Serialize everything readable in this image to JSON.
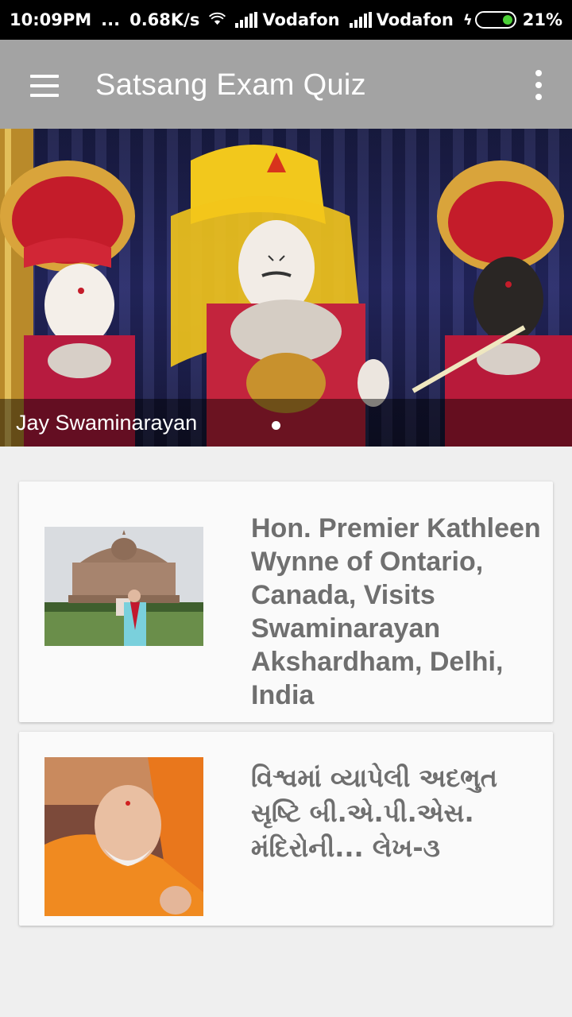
{
  "status_bar": {
    "time": "10:09PM",
    "dots": "...",
    "speed": "0.68K/s",
    "carrier1": "Vodafon",
    "carrier2": "Vodafon",
    "battery": "21%"
  },
  "app_bar": {
    "title": "Satsang Exam Quiz",
    "menu_icon": "hamburger-menu-icon",
    "overflow_icon": "more-vert-icon"
  },
  "banner": {
    "caption": "Jay Swaminarayan",
    "page_indicator": {
      "current": 1,
      "total": 1
    }
  },
  "articles": [
    {
      "title": "Hon. Premier Kathleen Wynne of Ontario, Canada, Visits Swaminarayan Akshardham, Delhi, India"
    },
    {
      "title": "વિશ્વમાં વ્યાપેલી અદભુત સૃષ્ટિ બી.એ.પી.એસ. મંદિરોની... લેખ-૩"
    }
  ],
  "colors": {
    "app_bar": "#a3a3a3",
    "background": "#efefef",
    "card": "#fafafa",
    "card_title": "#6f6f6f",
    "battery_fill": "#4cd137"
  }
}
